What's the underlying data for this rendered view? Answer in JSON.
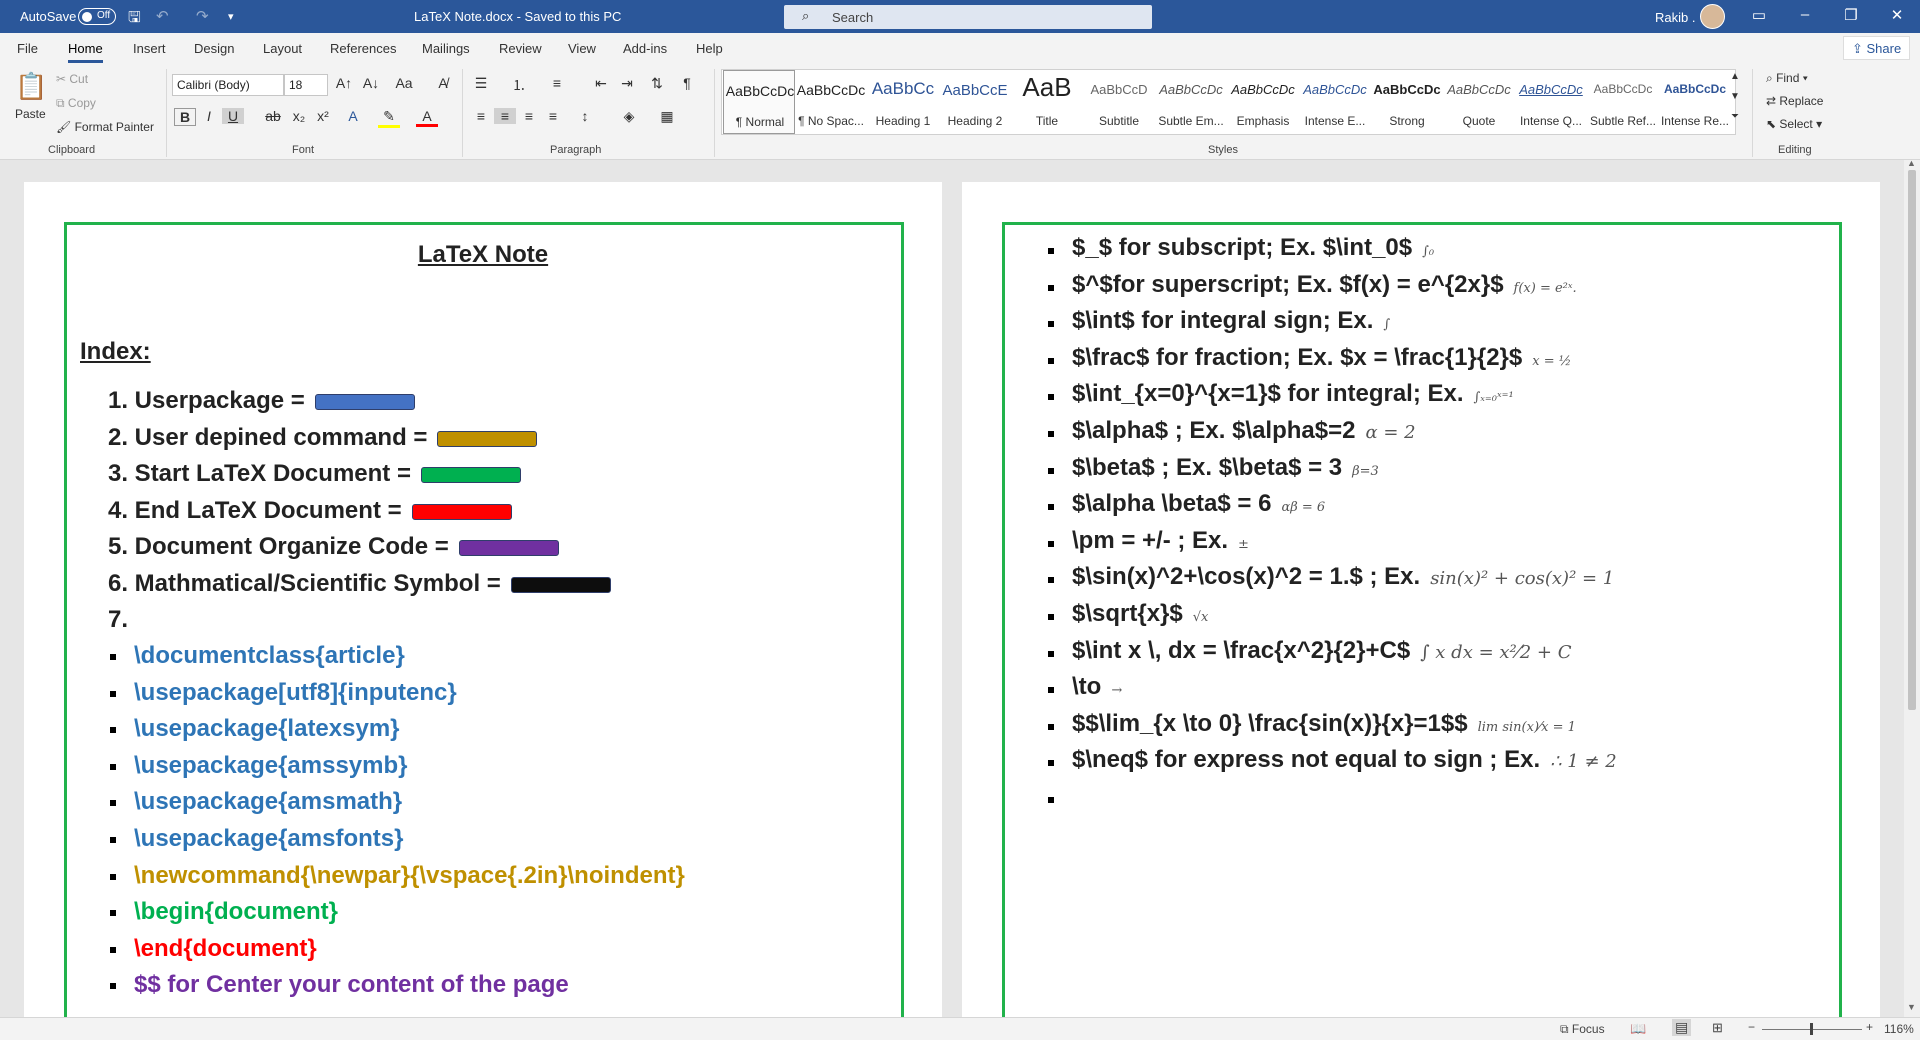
{
  "titlebar": {
    "autosave_label": "AutoSave",
    "autosave_state": "Off",
    "doc_title": "LaTeX Note.docx  -  Saved to this PC",
    "search_placeholder": "Search",
    "user": "Rakib ."
  },
  "tabs": [
    "File",
    "Home",
    "Insert",
    "Design",
    "Layout",
    "References",
    "Mailings",
    "Review",
    "View",
    "Add-ins",
    "Help"
  ],
  "share_label": "Share",
  "ribbon": {
    "clipboard": {
      "paste": "Paste",
      "cut": "Cut",
      "copy": "Copy",
      "format_painter": "Format Painter",
      "label": "Clipboard"
    },
    "font": {
      "family": "Calibri (Body)",
      "size": "18",
      "case_btn": "Aa",
      "label": "Font"
    },
    "paragraph_label": "Paragraph",
    "styles": [
      {
        "sample": "AaBbCcDc",
        "name": "¶ Normal"
      },
      {
        "sample": "AaBbCcDc",
        "name": "¶ No Spac..."
      },
      {
        "sample": "AaBbCc",
        "name": "Heading 1"
      },
      {
        "sample": "AaBbCcE",
        "name": "Heading 2"
      },
      {
        "sample": "AaB",
        "name": "Title"
      },
      {
        "sample": "AaBbCcD",
        "name": "Subtitle"
      },
      {
        "sample": "AaBbCcDc",
        "name": "Subtle Em..."
      },
      {
        "sample": "AaBbCcDc",
        "name": "Emphasis"
      },
      {
        "sample": "AaBbCcDc",
        "name": "Intense E..."
      },
      {
        "sample": "AaBbCcDc",
        "name": "Strong"
      },
      {
        "sample": "AaBbCcDc",
        "name": "Quote"
      },
      {
        "sample": "AaBbCcDc",
        "name": "Intense Q..."
      },
      {
        "sample": "AaBbCcDc",
        "name": "Subtle Ref..."
      },
      {
        "sample": "AaBbCcDc",
        "name": "Intense Re..."
      }
    ],
    "styles_label": "Styles",
    "editing": {
      "find": "Find",
      "replace": "Replace",
      "select": "Select",
      "label": "Editing"
    }
  },
  "page1": {
    "title": "LaTeX Note",
    "index_heading": "Index:",
    "index_items": [
      {
        "text": "1. Userpackage =",
        "color": "#4472c4"
      },
      {
        "text": "2. User depined command =",
        "color": "#bf9000"
      },
      {
        "text": "3. Start LaTeX Document =",
        "color": "#00b050"
      },
      {
        "text": "4. End LaTeX Document =",
        "color": "#ff0000"
      },
      {
        "text": "5. Document Organize Code =",
        "color": "#7030a0"
      },
      {
        "text": "6. Mathmatical/Scientific Symbol =",
        "color": "#0d0d0d"
      },
      {
        "text": "7.",
        "color": ""
      }
    ],
    "code_lines": [
      {
        "text": "\\documentclass{article}",
        "color": "#2e75b6"
      },
      {
        "text": "\\usepackage[utf8]{inputenc}",
        "color": "#2e75b6"
      },
      {
        "text": "\\usepackage{latexsym}",
        "color": "#2e75b6"
      },
      {
        "text": "\\usepackage{amssymb}",
        "color": "#2e75b6"
      },
      {
        "text": "\\usepackage{amsmath}",
        "color": "#2e75b6"
      },
      {
        "text": "\\usepackage{amsfonts}",
        "color": "#2e75b6"
      },
      {
        "text": "\\newcommand{\\newpar}{\\vspace{.2in}\\noindent}",
        "color": "#bf9000"
      },
      {
        "text": "\\begin{document}",
        "color": "#00b050"
      },
      {
        "text": "\\end{document}",
        "color": "#ff0000"
      },
      {
        "text": "$$ for Center your content of the page",
        "color": "#7030a0"
      }
    ]
  },
  "page2": {
    "lines": [
      {
        "text": "$_$ for subscript; Ex. $\\int_0$",
        "math": "∫₀"
      },
      {
        "text": "$^$for superscript; Ex. $f(x) = e^{2x}$",
        "math": "f(x) = e²ˣ."
      },
      {
        "text": "$\\int$ for integral sign; Ex.",
        "math": "∫"
      },
      {
        "text": "$\\frac$ for fraction; Ex. $x = \\frac{1}{2}$",
        "math": "x = ½"
      },
      {
        "text": "$\\int_{x=0}^{x=1}$ for integral; Ex.",
        "math": "∫ₓ₌₀ˣ⁼¹"
      },
      {
        "text": "$\\alpha$ ; Ex. $\\alpha$=2",
        "math": "α = 2"
      },
      {
        "text": "$\\beta$ ; Ex. $\\beta$ = 3",
        "math": "β=3"
      },
      {
        "text": "$\\alpha \\beta$ = 6",
        "math": "αβ = 6"
      },
      {
        "text": "\\pm = +/- ; Ex.",
        "math": "±"
      },
      {
        "text": "$\\sin(x)^2+\\cos(x)^2 = 1.$ ; Ex.",
        "math": "sin(x)² + cos(x)² = 1"
      },
      {
        "text": "$\\sqrt{x}$",
        "math": "√x"
      },
      {
        "text": "$\\int x \\, dx = \\frac{x^2}{2}+C$",
        "math": "∫ x dx = x²⁄2 + C"
      },
      {
        "text": "\\to",
        "math": "→"
      },
      {
        "text": "$$\\lim_{x \\to 0} \\frac{sin(x)}{x}=1$$",
        "math": "lim sin(x)⁄x = 1"
      },
      {
        "text": "$\\neq$ for express not equal to sign ; Ex.",
        "math": "∴ 1 ≠ 2"
      },
      {
        "text": "",
        "math": ""
      }
    ]
  },
  "status": {
    "focus": "Focus",
    "zoom": "116%"
  }
}
